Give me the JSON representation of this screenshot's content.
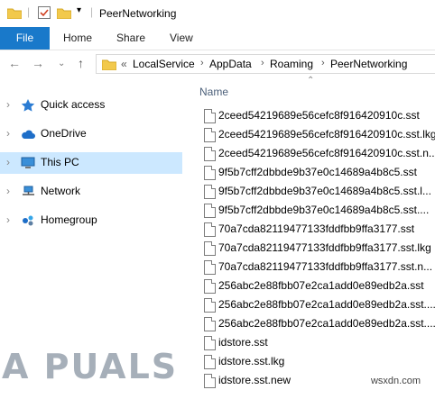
{
  "window": {
    "title": "PeerNetworking"
  },
  "ribbon": {
    "tabs": [
      "File",
      "Home",
      "Share",
      "View"
    ]
  },
  "address": {
    "overflow": "«",
    "crumbs": [
      "LocalService",
      "AppData",
      "Roaming",
      "PeerNetworking"
    ],
    "separator": "›"
  },
  "navigation": {
    "items": [
      {
        "label": "Quick access",
        "icon": "star-icon"
      },
      {
        "label": "OneDrive",
        "icon": "cloud-icon"
      },
      {
        "label": "This PC",
        "icon": "computer-icon",
        "selected": true
      },
      {
        "label": "Network",
        "icon": "network-icon"
      },
      {
        "label": "Homegroup",
        "icon": "homegroup-icon"
      }
    ]
  },
  "list": {
    "column_header": "Name",
    "files": [
      "2ceed54219689e56cefc8f916420910c.sst",
      "2ceed54219689e56cefc8f916420910c.sst.lkg",
      "2ceed54219689e56cefc8f916420910c.sst.n...",
      "9f5b7cff2dbbde9b37e0c14689a4b8c5.sst",
      "9f5b7cff2dbbde9b37e0c14689a4b8c5.sst.l...",
      "9f5b7cff2dbbde9b37e0c14689a4b8c5.sst....",
      "70a7cda82119477133fddfbb9ffa3177.sst",
      "70a7cda82119477133fddfbb9ffa3177.sst.lkg",
      "70a7cda82119477133fddfbb9ffa3177.sst.n...",
      "256abc2e88fbb07e2ca1add0e89edb2a.sst",
      "256abc2e88fbb07e2ca1add0e89edb2a.sst....",
      "256abc2e88fbb07e2ca1add0e89edb2a.sst....",
      "idstore.sst",
      "idstore.sst.lkg",
      "idstore.sst.new"
    ]
  },
  "watermarks": {
    "logo": "A PUALS",
    "site": "wsxdn.com"
  },
  "colors": {
    "accent": "#1979ca",
    "selection": "#cce8ff",
    "folder": "#f2c94c"
  }
}
